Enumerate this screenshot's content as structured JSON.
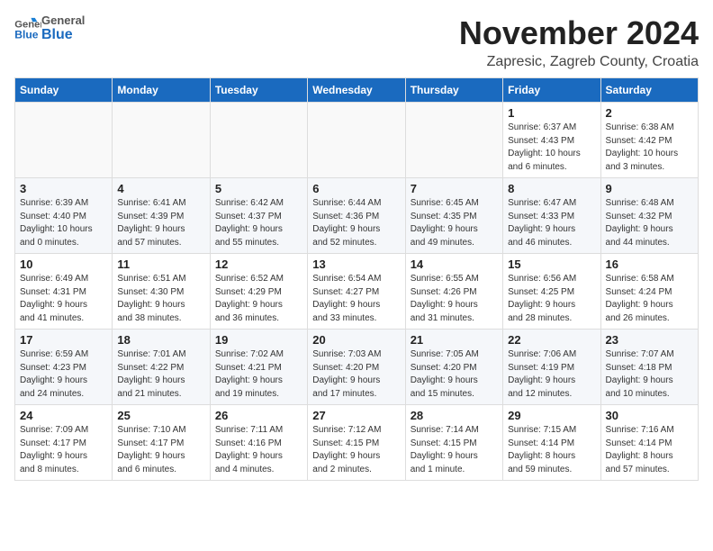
{
  "header": {
    "logo_general": "General",
    "logo_blue": "Blue",
    "month_title": "November 2024",
    "location": "Zapresic, Zagreb County, Croatia"
  },
  "weekdays": [
    "Sunday",
    "Monday",
    "Tuesday",
    "Wednesday",
    "Thursday",
    "Friday",
    "Saturday"
  ],
  "weeks": [
    {
      "cells": [
        {
          "day": "",
          "info": ""
        },
        {
          "day": "",
          "info": ""
        },
        {
          "day": "",
          "info": ""
        },
        {
          "day": "",
          "info": ""
        },
        {
          "day": "",
          "info": ""
        },
        {
          "day": "1",
          "info": "Sunrise: 6:37 AM\nSunset: 4:43 PM\nDaylight: 10 hours\nand 6 minutes."
        },
        {
          "day": "2",
          "info": "Sunrise: 6:38 AM\nSunset: 4:42 PM\nDaylight: 10 hours\nand 3 minutes."
        }
      ]
    },
    {
      "cells": [
        {
          "day": "3",
          "info": "Sunrise: 6:39 AM\nSunset: 4:40 PM\nDaylight: 10 hours\nand 0 minutes."
        },
        {
          "day": "4",
          "info": "Sunrise: 6:41 AM\nSunset: 4:39 PM\nDaylight: 9 hours\nand 57 minutes."
        },
        {
          "day": "5",
          "info": "Sunrise: 6:42 AM\nSunset: 4:37 PM\nDaylight: 9 hours\nand 55 minutes."
        },
        {
          "day": "6",
          "info": "Sunrise: 6:44 AM\nSunset: 4:36 PM\nDaylight: 9 hours\nand 52 minutes."
        },
        {
          "day": "7",
          "info": "Sunrise: 6:45 AM\nSunset: 4:35 PM\nDaylight: 9 hours\nand 49 minutes."
        },
        {
          "day": "8",
          "info": "Sunrise: 6:47 AM\nSunset: 4:33 PM\nDaylight: 9 hours\nand 46 minutes."
        },
        {
          "day": "9",
          "info": "Sunrise: 6:48 AM\nSunset: 4:32 PM\nDaylight: 9 hours\nand 44 minutes."
        }
      ]
    },
    {
      "cells": [
        {
          "day": "10",
          "info": "Sunrise: 6:49 AM\nSunset: 4:31 PM\nDaylight: 9 hours\nand 41 minutes."
        },
        {
          "day": "11",
          "info": "Sunrise: 6:51 AM\nSunset: 4:30 PM\nDaylight: 9 hours\nand 38 minutes."
        },
        {
          "day": "12",
          "info": "Sunrise: 6:52 AM\nSunset: 4:29 PM\nDaylight: 9 hours\nand 36 minutes."
        },
        {
          "day": "13",
          "info": "Sunrise: 6:54 AM\nSunset: 4:27 PM\nDaylight: 9 hours\nand 33 minutes."
        },
        {
          "day": "14",
          "info": "Sunrise: 6:55 AM\nSunset: 4:26 PM\nDaylight: 9 hours\nand 31 minutes."
        },
        {
          "day": "15",
          "info": "Sunrise: 6:56 AM\nSunset: 4:25 PM\nDaylight: 9 hours\nand 28 minutes."
        },
        {
          "day": "16",
          "info": "Sunrise: 6:58 AM\nSunset: 4:24 PM\nDaylight: 9 hours\nand 26 minutes."
        }
      ]
    },
    {
      "cells": [
        {
          "day": "17",
          "info": "Sunrise: 6:59 AM\nSunset: 4:23 PM\nDaylight: 9 hours\nand 24 minutes."
        },
        {
          "day": "18",
          "info": "Sunrise: 7:01 AM\nSunset: 4:22 PM\nDaylight: 9 hours\nand 21 minutes."
        },
        {
          "day": "19",
          "info": "Sunrise: 7:02 AM\nSunset: 4:21 PM\nDaylight: 9 hours\nand 19 minutes."
        },
        {
          "day": "20",
          "info": "Sunrise: 7:03 AM\nSunset: 4:20 PM\nDaylight: 9 hours\nand 17 minutes."
        },
        {
          "day": "21",
          "info": "Sunrise: 7:05 AM\nSunset: 4:20 PM\nDaylight: 9 hours\nand 15 minutes."
        },
        {
          "day": "22",
          "info": "Sunrise: 7:06 AM\nSunset: 4:19 PM\nDaylight: 9 hours\nand 12 minutes."
        },
        {
          "day": "23",
          "info": "Sunrise: 7:07 AM\nSunset: 4:18 PM\nDaylight: 9 hours\nand 10 minutes."
        }
      ]
    },
    {
      "cells": [
        {
          "day": "24",
          "info": "Sunrise: 7:09 AM\nSunset: 4:17 PM\nDaylight: 9 hours\nand 8 minutes."
        },
        {
          "day": "25",
          "info": "Sunrise: 7:10 AM\nSunset: 4:17 PM\nDaylight: 9 hours\nand 6 minutes."
        },
        {
          "day": "26",
          "info": "Sunrise: 7:11 AM\nSunset: 4:16 PM\nDaylight: 9 hours\nand 4 minutes."
        },
        {
          "day": "27",
          "info": "Sunrise: 7:12 AM\nSunset: 4:15 PM\nDaylight: 9 hours\nand 2 minutes."
        },
        {
          "day": "28",
          "info": "Sunrise: 7:14 AM\nSunset: 4:15 PM\nDaylight: 9 hours\nand 1 minute."
        },
        {
          "day": "29",
          "info": "Sunrise: 7:15 AM\nSunset: 4:14 PM\nDaylight: 8 hours\nand 59 minutes."
        },
        {
          "day": "30",
          "info": "Sunrise: 7:16 AM\nSunset: 4:14 PM\nDaylight: 8 hours\nand 57 minutes."
        }
      ]
    }
  ]
}
